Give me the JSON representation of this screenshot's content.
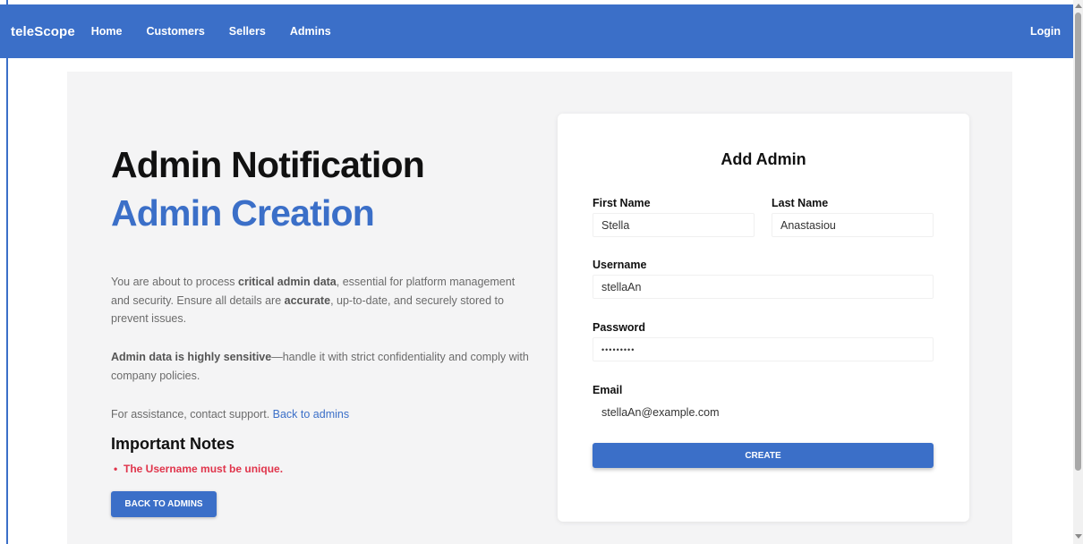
{
  "navbar": {
    "brand": "teleScope",
    "links": [
      "Home",
      "Customers",
      "Sellers",
      "Admins"
    ],
    "login": "Login"
  },
  "hero": {
    "title": "Admin Notification",
    "subtitle": "Admin Creation"
  },
  "intro": {
    "p1_a": "You are about to process ",
    "p1_b": "critical admin data",
    "p1_c": ", essential for platform management and security. Ensure all details are ",
    "p1_d": "accurate",
    "p1_e": ", up-to-date, and securely stored to prevent issues.",
    "p2_a": "Admin data is highly sensitive",
    "p2_b": "—handle it with strict confidentiality and comply with company policies.",
    "p3_a": "For assistance, contact support. ",
    "p3_link": "Back to admins"
  },
  "notes": {
    "title": "Important Notes",
    "items": [
      "The Username must be unique."
    ]
  },
  "back_button": "BACK TO ADMINS",
  "form": {
    "title": "Add Admin",
    "first_name_label": "First Name",
    "first_name_value": "Stella",
    "last_name_label": "Last Name",
    "last_name_value": "Anastasiou",
    "username_label": "Username",
    "username_value": "stellaAn",
    "password_label": "Password",
    "password_value": "•••••••••",
    "email_label": "Email",
    "email_value": "stellaAn@example.com",
    "submit_label": "CREATE"
  },
  "colors": {
    "primary": "#3b6fc8",
    "danger": "#e0344b",
    "panel_bg": "#f4f4f5"
  }
}
